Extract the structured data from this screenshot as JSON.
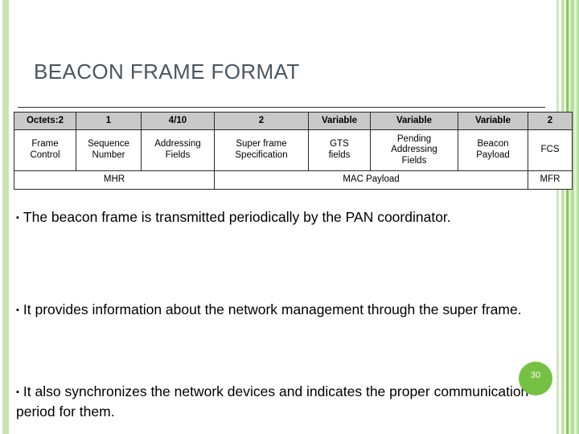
{
  "slide": {
    "title": "BEACON FRAME FORMAT",
    "page_number": "30",
    "accent_green": "#76c043",
    "title_color": "#4a5560",
    "stripe_green": "#c9e4b4"
  },
  "frame_table": {
    "octets_row": [
      "Octets:2",
      "1",
      "4/10",
      "2",
      "Variable",
      "Variable",
      "Variable",
      "2"
    ],
    "field_row": [
      "Frame\nControl",
      "Sequence\nNumber",
      "Addressing\nFields",
      "Super frame\nSpecification",
      "GTS\nfields",
      "Pending\nAddressing\nFields",
      "Beacon\nPayload",
      "FCS"
    ],
    "group_row": [
      "MHR",
      "MAC Payload",
      "MFR"
    ]
  },
  "bullets": [
    {
      "marker": "▪",
      "text": "The beacon frame is transmitted periodically by the PAN coordinator."
    },
    {
      "marker": "▪",
      "text": "It provides information about the network management through the super frame."
    },
    {
      "marker": "▪",
      "text": "It also synchronizes the network devices and indicates the proper communication period for them."
    }
  ]
}
